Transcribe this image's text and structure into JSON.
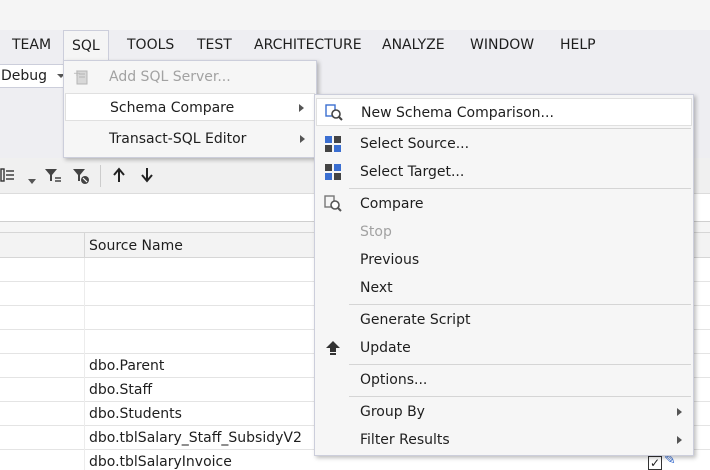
{
  "menubar": {
    "items": [
      "TEAM",
      "SQL",
      "TOOLS",
      "TEST",
      "ARCHITECTURE",
      "ANALYZE",
      "WINDOW",
      "HELP"
    ]
  },
  "toolbar": {
    "config_value": "Debug"
  },
  "sql_menu": {
    "items": [
      {
        "label": "Add SQL Server...",
        "disabled": true
      },
      {
        "label": "Schema Compare",
        "submenu": true,
        "highlighted": true
      },
      {
        "label": "Transact-SQL Editor",
        "submenu": true
      }
    ]
  },
  "schema_compare_menu": {
    "items": [
      {
        "label": "New Schema Comparison...",
        "icon": "schema-compare-icon",
        "highlighted": true
      },
      {
        "label": "Select Source...",
        "icon": "database-select-icon"
      },
      {
        "label": "Select Target...",
        "icon": "database-select-icon"
      },
      {
        "label": "Compare",
        "icon": "compare-icon"
      },
      {
        "label": "Stop",
        "disabled": true
      },
      {
        "label": "Previous"
      },
      {
        "label": "Next"
      },
      {
        "label": "Generate Script"
      },
      {
        "label": "Update",
        "icon": "update-arrow-icon"
      },
      {
        "label": "Options..."
      },
      {
        "label": "Group By",
        "submenu": true
      },
      {
        "label": "Filter Results",
        "submenu": true
      }
    ]
  },
  "grid": {
    "column_header": "Source Name",
    "rows": [
      "",
      "",
      "",
      "",
      "dbo.Parent",
      "dbo.Staff",
      "dbo.Students",
      "dbo.tblSalary_Staff_SubsidyV2",
      "dbo.tblSalaryInvoice"
    ]
  },
  "colors": {
    "menu_bg": "#f6f6f6",
    "menubar_bg": "#eeeef2",
    "disabled_text": "#a2a2a2",
    "icon_blue": "#3b6fd1"
  }
}
